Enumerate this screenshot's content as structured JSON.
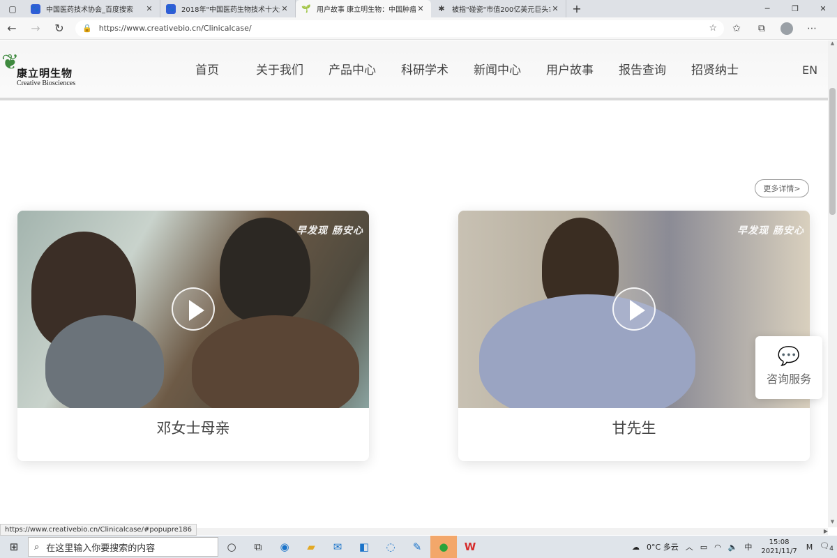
{
  "browser": {
    "tabs": [
      {
        "title": "中国医药技术协会_百度搜索",
        "favicon": "baidu-icon",
        "active": false
      },
      {
        "title": "2018年\"中国医药生物技术十大进",
        "favicon": "baidu-icon",
        "active": false
      },
      {
        "title": "用户故事 康立明生物：中国肿瘤",
        "favicon": "leaf-icon",
        "active": true
      },
      {
        "title": "被指\"碰瓷\"市值200亿美元巨头?",
        "favicon": "bug-icon",
        "active": false
      }
    ],
    "url": "https://www.creativebio.cn/Clinicalcase/",
    "status_url": "https://www.creativebio.cn/Clinicalcase/#popupre186"
  },
  "site": {
    "logo_cn": "康立明生物",
    "logo_en": "Creative Biosciences",
    "nav": [
      "首页",
      "关于我们",
      "产品中心",
      "科研学术",
      "新闻中心",
      "用户故事",
      "报告查询",
      "招贤纳士"
    ],
    "lang": "EN",
    "more_label": "更多详情>",
    "cards": [
      {
        "name": "邓女士母亲",
        "slogan": "早发现 肠安心"
      },
      {
        "name": "甘先生",
        "slogan": "早发现 肠安心"
      }
    ],
    "consult_label": "咨询服务"
  },
  "taskbar": {
    "search_placeholder": "在这里输入你要搜索的内容",
    "weather": "0°C 多云",
    "ime": "中",
    "time": "15:08",
    "date": "2021/11/7",
    "notif_count": "4"
  }
}
